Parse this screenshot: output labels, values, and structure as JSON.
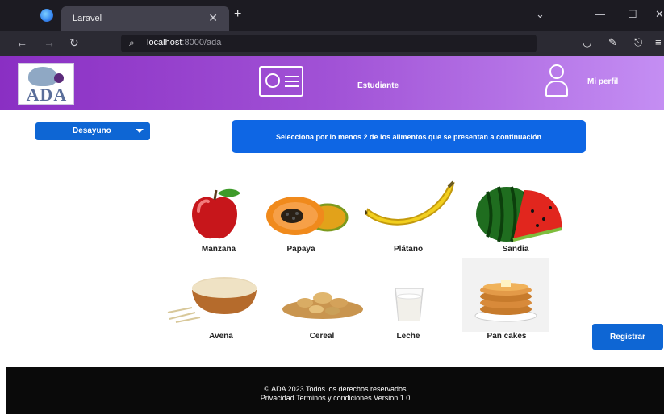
{
  "browser": {
    "tab_title": "Laravel",
    "url_host": "localhost",
    "url_rest": ":8000/ada"
  },
  "header": {
    "logo_text": "ADA",
    "student_label": "Estudiante",
    "profile_label": "Mi perfil"
  },
  "controls": {
    "meal_select_value": "Desayuno",
    "instruction": "Selecciona por lo menos 2 de los alimentos que se presentan a continuación",
    "register_label": "Registrar"
  },
  "foods": [
    {
      "label": "Manzana"
    },
    {
      "label": "Papaya"
    },
    {
      "label": "Plátano"
    },
    {
      "label": "Sandia"
    },
    {
      "label": "Avena"
    },
    {
      "label": "Cereal"
    },
    {
      "label": "Leche"
    },
    {
      "label": "Pan cakes"
    }
  ],
  "footer": {
    "line1": "© ADA 2023 Todos los derechos reservados",
    "line2": "Privacidad  Terminos y condiciones Version 1.0"
  },
  "colors": {
    "primary_blue": "#0e66d4",
    "header_gradient_start": "#8a2fc3",
    "header_gradient_end": "#c48ef3",
    "footer": "#0a0a0a"
  }
}
